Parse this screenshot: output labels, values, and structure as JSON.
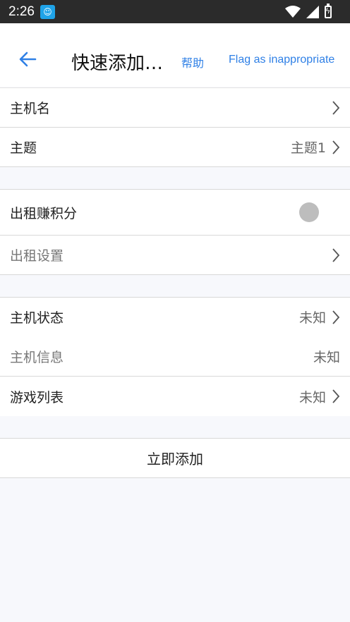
{
  "status_bar": {
    "time": "2:26"
  },
  "header": {
    "title": "快速添加…",
    "help_label": "帮助",
    "flag_label": "Flag as inappropriate"
  },
  "rows": {
    "host_name": {
      "label": "主机名"
    },
    "theme": {
      "label": "主题",
      "value": "主题1"
    },
    "rent_points": {
      "label": "出租赚积分"
    },
    "rent_settings": {
      "label": "出租设置"
    },
    "host_status": {
      "label": "主机状态",
      "value": "未知"
    },
    "host_info": {
      "label": "主机信息",
      "value": "未知"
    },
    "game_list": {
      "label": "游戏列表",
      "value": "未知"
    }
  },
  "actions": {
    "add_now": "立即添加"
  },
  "colors": {
    "accent": "#2f80e6",
    "status_bar": "#2b2b2b",
    "background": "#f7f8fc"
  }
}
